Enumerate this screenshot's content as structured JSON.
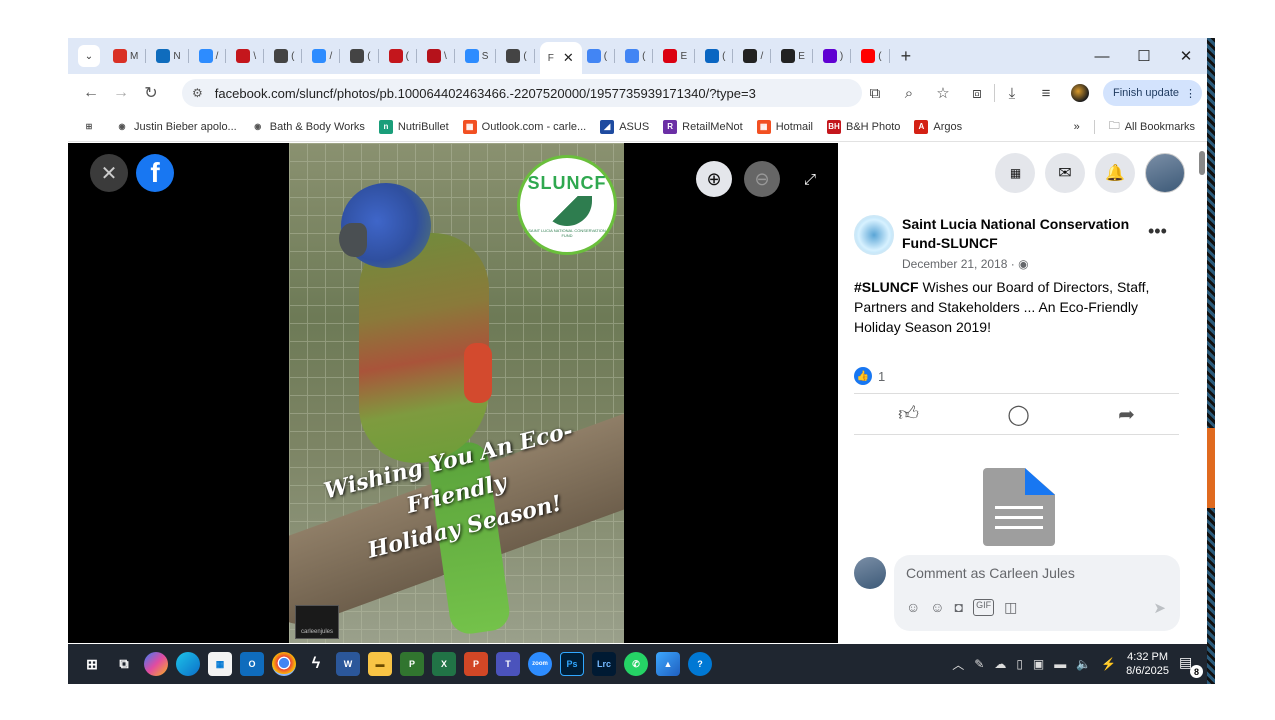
{
  "browser": {
    "tabs": [
      {
        "icon": "gmail-icon",
        "label": "M",
        "color": "#d93025"
      },
      {
        "icon": "outlook-icon",
        "label": "N",
        "color": "#0f6cbd"
      },
      {
        "icon": "zoom-icon",
        "label": "/",
        "color": "#2d8cff"
      },
      {
        "icon": "bh-icon",
        "label": "\\",
        "color": "#c4161c"
      },
      {
        "icon": "chatgpt-icon",
        "label": "(",
        "color": "#444444"
      },
      {
        "icon": "zoom-icon",
        "label": "/",
        "color": "#2d8cff"
      },
      {
        "icon": "chatgpt-icon",
        "label": "(",
        "color": "#444444"
      },
      {
        "icon": "bh-icon",
        "label": "(",
        "color": "#c4161c"
      },
      {
        "icon": "news-icon",
        "label": "\\",
        "color": "#b5121b"
      },
      {
        "icon": "zoom-icon",
        "label": "S",
        "color": "#2d8cff"
      },
      {
        "icon": "chatgpt-icon",
        "label": "(",
        "color": "#444444"
      }
    ],
    "active_tab": {
      "label": "F",
      "close": "✕"
    },
    "tabs_after": [
      {
        "icon": "google-icon",
        "label": "(",
        "color": "#4285f4"
      },
      {
        "icon": "google-icon",
        "label": "(",
        "color": "#4285f4"
      },
      {
        "icon": "hsbc-icon",
        "label": "E",
        "color": "#db0011"
      },
      {
        "icon": "linkedin-icon",
        "label": "(",
        "color": "#0a66c2"
      },
      {
        "icon": "amazon-icon",
        "label": "/",
        "color": "#222222"
      },
      {
        "icon": "dji-icon",
        "label": "E",
        "color": "#222222"
      },
      {
        "icon": "yahoo-icon",
        "label": ")",
        "color": "#6001d2"
      },
      {
        "icon": "youtube-icon",
        "label": "(",
        "color": "#ff0000"
      }
    ],
    "new_tab": "+",
    "window_controls": {
      "minimize": "—",
      "maximize": "☐",
      "close": "✕"
    },
    "url": "facebook.com/sluncf/photos/pb.100064402463466.-2207520000/1957735939171340/?type=3",
    "finish_update": "Finish update",
    "bookmarks": [
      {
        "icon": "apps-grid-icon",
        "label": "",
        "color": "#555555",
        "glyph": "⊞"
      },
      {
        "icon": "globe-icon",
        "label": "Justin Bieber apolo...",
        "color": "#555555",
        "glyph": "◉"
      },
      {
        "icon": "globe-icon",
        "label": "Bath & Body Works",
        "color": "#555555",
        "glyph": "◉"
      },
      {
        "icon": "nutribullet-icon",
        "label": "NutriBullet",
        "color": "#1a9e7a",
        "glyph": "n"
      },
      {
        "icon": "microsoft-icon",
        "label": "Outlook.com - carle...",
        "color": "#f25022",
        "glyph": "▦"
      },
      {
        "icon": "asus-icon",
        "label": "ASUS",
        "color": "#1e4ba0",
        "glyph": "◢"
      },
      {
        "icon": "retailmenot-icon",
        "label": "RetailMeNot",
        "color": "#6b2fa5",
        "glyph": "R"
      },
      {
        "icon": "microsoft-icon",
        "label": "Hotmail",
        "color": "#f25022",
        "glyph": "▦"
      },
      {
        "icon": "bh-icon",
        "label": "B&H Photo",
        "color": "#c4161c",
        "glyph": "BH"
      },
      {
        "icon": "argos-icon",
        "label": "Argos",
        "color": "#d42114",
        "glyph": "A"
      }
    ],
    "bookmarks_overflow": "»",
    "all_bookmarks": "All Bookmarks"
  },
  "viewer": {
    "close_glyph": "✕",
    "fb_glyph": "f",
    "zoom_in_glyph": "⊕",
    "zoom_out_glyph": "⊖",
    "fullscreen_glyph": "⤢",
    "photo": {
      "logo_text": "SLUNCF",
      "logo_subtext": "SAINT LUCIA NATIONAL CONSERVATION FUND",
      "greeting_line1": "Wishing You An Eco-Friendly",
      "greeting_line2": "Holiday Season!",
      "credit": "carleenjules"
    }
  },
  "post": {
    "page_name": "Saint Lucia National Conservation Fund-SLUNCF",
    "date": "December 21, 2018 · ",
    "privacy_glyph": "🌐",
    "more": "•••",
    "hashtag": "#SLUNCF",
    "text": " Wishes our Board of Directors, Staff, Partners and Stakeholders ... An Eco-Friendly Holiday Season 2019!",
    "like_count": "1",
    "comment_placeholder": "Comment as Carleen Jules"
  },
  "side_icons": {
    "menu": "⋮⋮⋮",
    "messenger": "✉",
    "notifications": "🔔"
  },
  "taskbar": {
    "time": "4:32 PM",
    "date": "8/6/2025",
    "notification_count": "8"
  }
}
